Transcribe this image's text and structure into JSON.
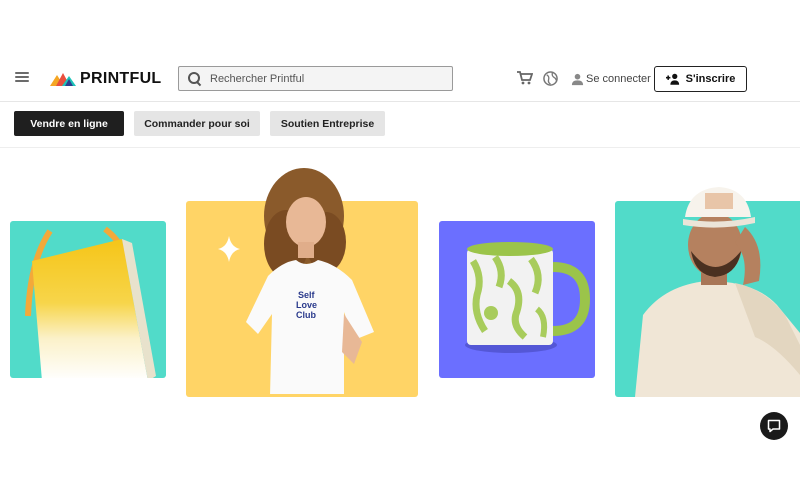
{
  "header": {
    "menu_icon": "hamburger-menu-icon",
    "logo_text": "PRINTFUL",
    "search": {
      "placeholder": "Rechercher Printful",
      "value": ""
    },
    "cart_icon": "cart-icon",
    "language_icon": "globe-icon",
    "login_label": "Se connecter",
    "signup_label": "S'inscrire"
  },
  "tabs": [
    {
      "label": "Vendre en ligne",
      "active": true
    },
    {
      "label": "Commander pour soi",
      "active": false
    },
    {
      "label": "Soutien Entreprise",
      "active": false
    }
  ],
  "hero": {
    "shirt_print": [
      "Self",
      "Love",
      "Club"
    ]
  },
  "colors": {
    "teal": "#51dbc9",
    "yellow": "#ffd466",
    "violet": "#6b6fff",
    "dark": "#1f1f1f",
    "tab_grey": "#e5e5e5"
  },
  "chat_icon": "chat-bubble-icon"
}
